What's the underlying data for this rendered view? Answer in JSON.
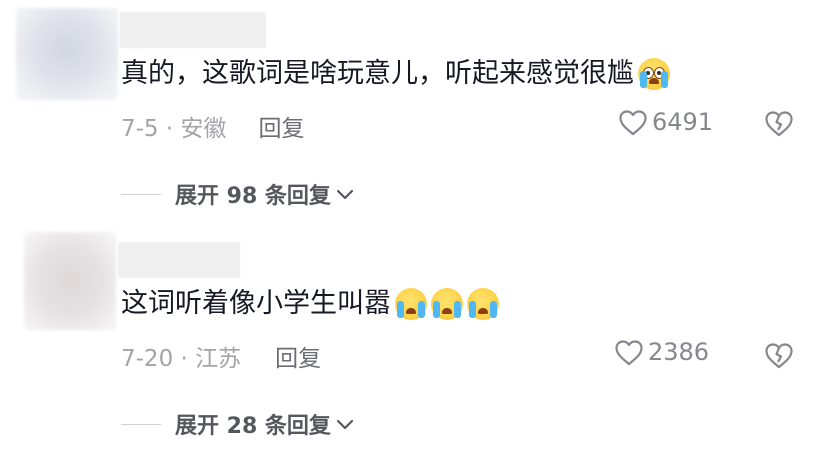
{
  "comments": [
    {
      "text": "真的，这歌词是啥玩意儿，听起来感觉很尴",
      "emoji_icons": [
        "dizzy-crying-emoji-icon"
      ],
      "date_location": "7-5 · 安徽",
      "reply_label": "回复",
      "likes": "6491",
      "expand_label": "展开 98 条回复"
    },
    {
      "text": "这词听着像小学生叫嚣",
      "emoji_icons": [
        "loudly-crying-emoji-icon",
        "loudly-crying-emoji-icon",
        "loudly-crying-emoji-icon"
      ],
      "date_location": "7-20 · 江苏",
      "reply_label": "回复",
      "likes": "2386",
      "expand_label": "展开 28 条回复"
    }
  ],
  "colors": {
    "text_primary": "#161823",
    "text_secondary": "#a3a4a8",
    "reply": "#6c6d73",
    "icon": "#86878c",
    "emoji_face": "#fcd24a",
    "emoji_tear": "#4fb7f2"
  }
}
